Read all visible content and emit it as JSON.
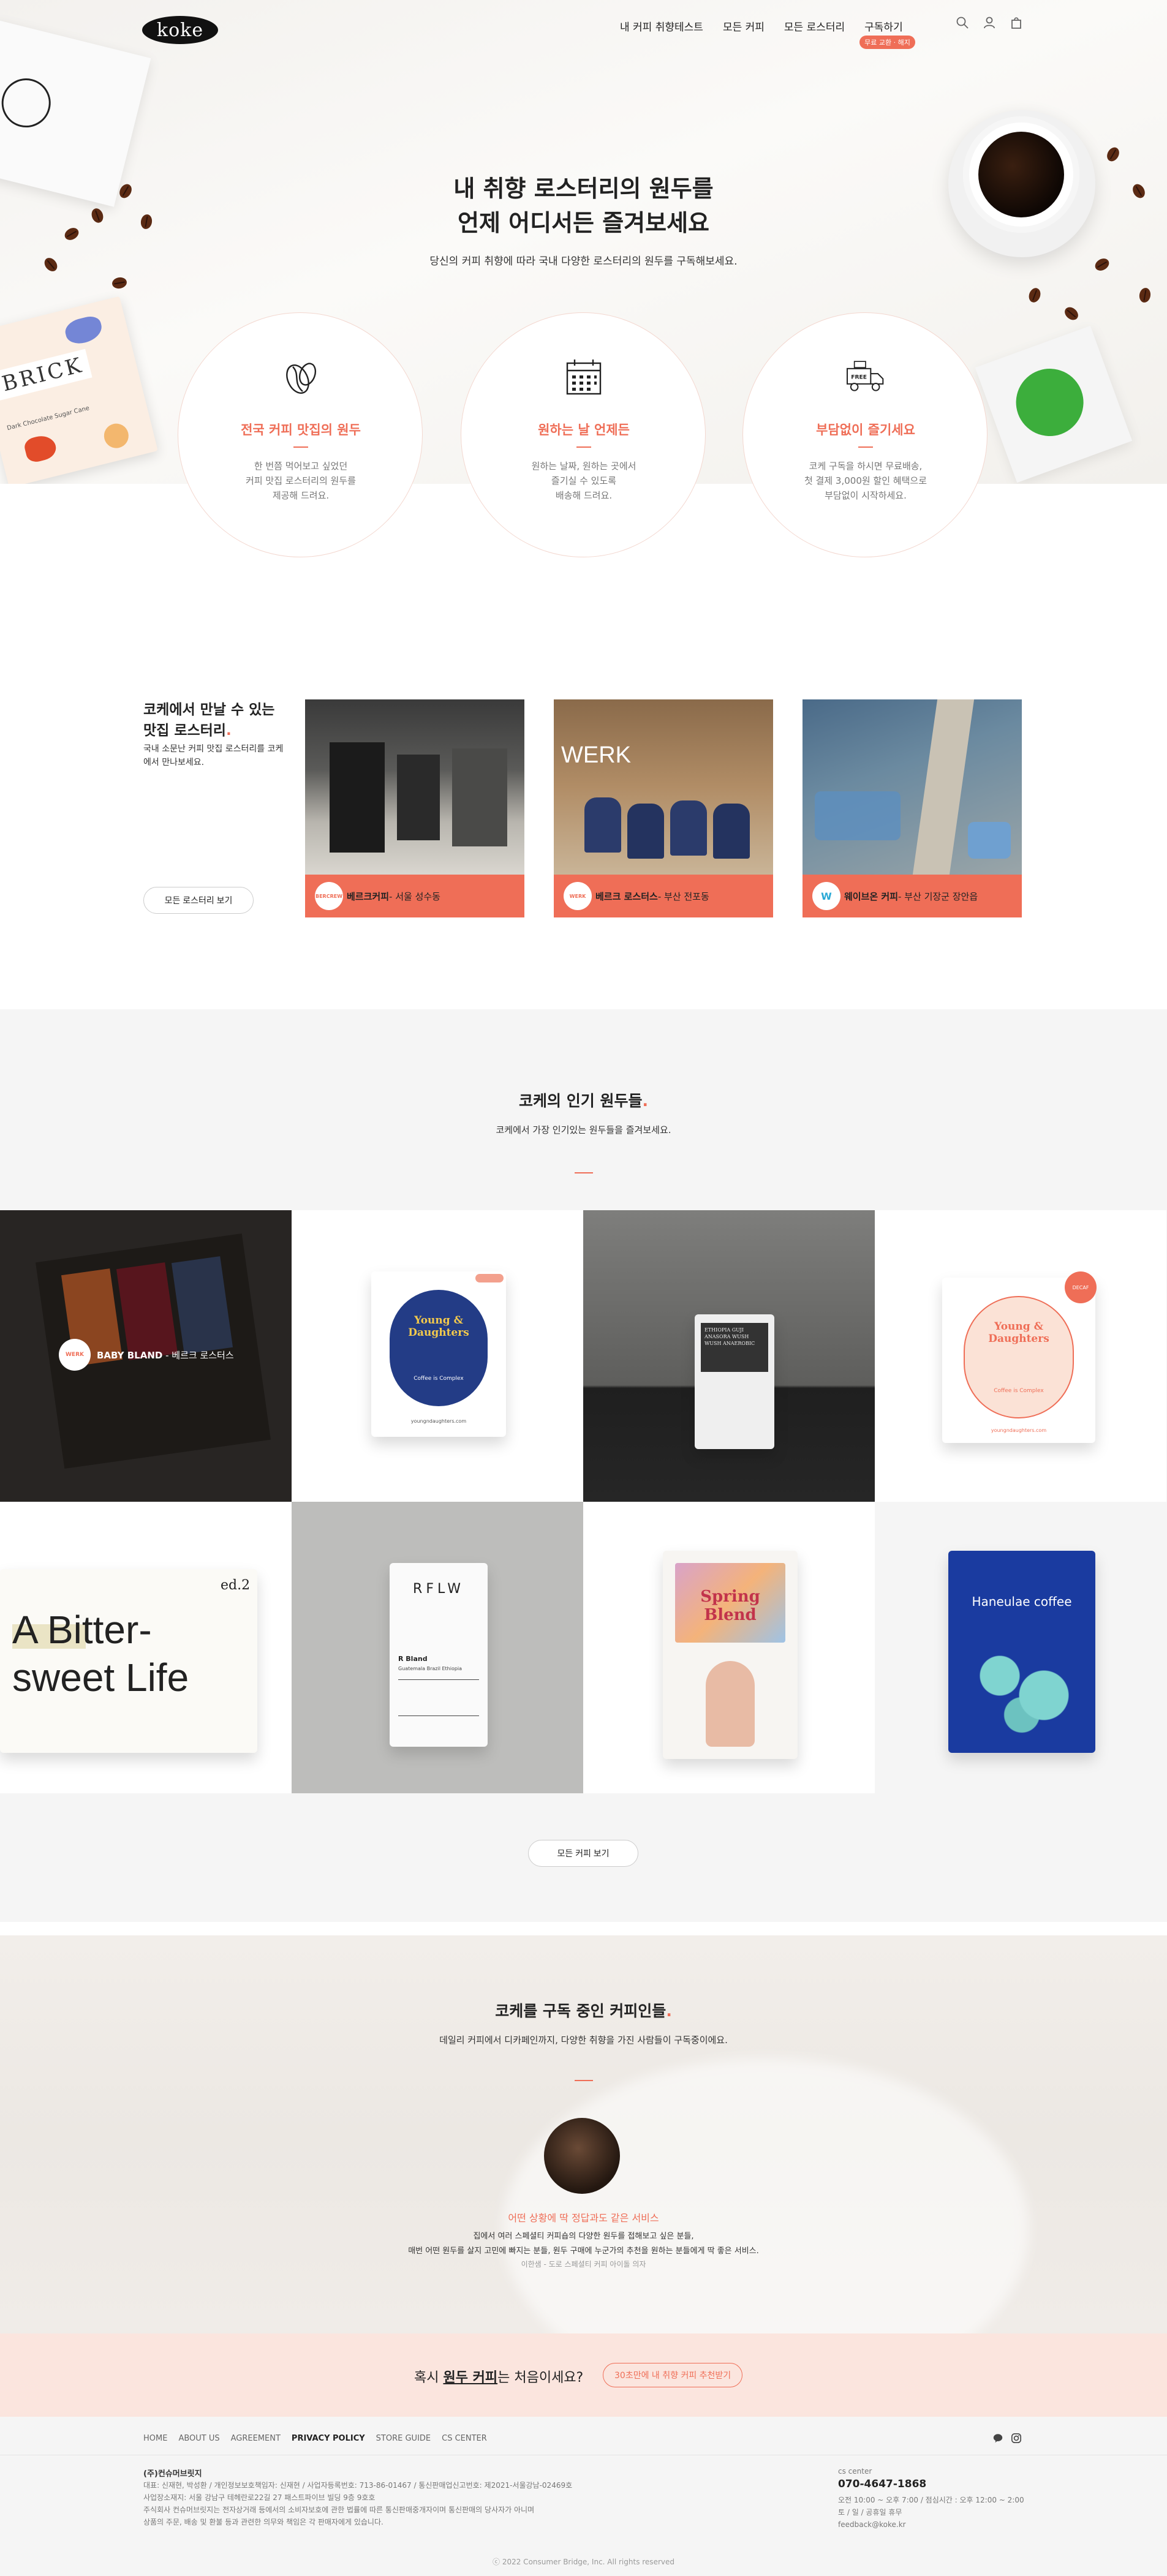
{
  "brand": {
    "logo_text": "koke",
    "accent": "#ef6e57"
  },
  "nav": {
    "items": [
      "내 커피 취향테스트",
      "모든 커피",
      "모든 로스터리",
      "구독하기"
    ],
    "subscribe_badge": "무료 교환 · 해지"
  },
  "header_icons": [
    "search-icon",
    "user-icon",
    "cart-icon"
  ],
  "hero": {
    "title_line1": "내 취향 로스터리의 원두를",
    "title_line2": "언제 어디서든 즐겨보세요",
    "subtitle": "당신의 커피 취향에 따라 국내 다양한 로스터리의 원두를 구독해보세요.",
    "package_text": "BRICK",
    "package_sub": "Dark Chocolate Sugar Cane",
    "free_truck_label": "FREE"
  },
  "features": [
    {
      "icon": "coffee-bean-icon",
      "title": "전국 커피 맛집의 원두",
      "desc": "한 번쯤 먹어보고 싶었던\n커피 맛집 로스터리의 원두를\n제공해 드려요."
    },
    {
      "icon": "calendar-icon",
      "title": "원하는 날 언제든",
      "desc": "원하는 날짜, 원하는 곳에서\n즐기실 수 있도록\n배송해 드려요."
    },
    {
      "icon": "free-delivery-truck-icon",
      "title": "부담없이 즐기세요",
      "desc": "코케 구독을 하시면 무료배송,\n첫 결제 3,000원 할인 혜택으로\n부담없이 시작하세요."
    }
  ],
  "roasters": {
    "title_line1": "코케에서 만날 수 있는",
    "title_line2": "맛집 로스터리",
    "title_dot": ".",
    "desc": "국내 소문난 커피 맛집 로스터리를 코케에서 만나보세요.",
    "button": "모든 로스터리 보기",
    "cards": [
      {
        "name": "베르크커피",
        "location": " - 서울 성수동",
        "logo": "BERCREW"
      },
      {
        "name": "베르크 로스터스",
        "location": " - 부산 전포동",
        "logo": "WERK",
        "photo_text": "WERK"
      },
      {
        "name": "웨이브온 커피",
        "location": " - 부산 기장군 장안읍",
        "logo": "W"
      }
    ]
  },
  "popular": {
    "title": "코케의 인기 원두들",
    "title_dot": ".",
    "subtitle": "코케에서 가장 인기있는 원두들을 즐겨보세요.",
    "overlay_brand": "BABY BLAND",
    "overlay_roaster": " - 베르크 로스터스",
    "overlay_logo": "WERK",
    "products": [
      {
        "label": "Young & Daughters",
        "sub": "Coffee is Complex",
        "site": "youngndaughters.com"
      },
      {
        "label": "ETHIOPIA GUJI ANASORA WUSH WUSH ANAEROBIC"
      },
      {
        "label": "Young & Daughters",
        "sub": "Coffee is Complex",
        "site": "youngndaughters.com",
        "badge": "DECAF"
      },
      {
        "label": "A Bitter-sweet Life",
        "top": "ed.2"
      },
      {
        "label": "RFLW",
        "sub": "R Bland",
        "detail": "Guatemala Brazil Ethiopia"
      },
      {
        "label": "Spring Blend"
      },
      {
        "label": "Haneulae coffee"
      }
    ],
    "button": "모든 커피 보기"
  },
  "subscribers": {
    "title": "코케를 구독 중인 커피인들",
    "title_dot": ".",
    "subtitle": "데일리 커피에서 디카페인까지, 다양한 취향을 가진 사람들이 구독중이에요.",
    "quote_title": "어떤 상황에 딱 정답과도 같은 서비스",
    "quote_text": "집에서 여러 스페셜티 커피숍의 다양한 원두를 접해보고 싶은 분들,\n매번 어떤 원두를 살지 고민에 빠지는 분들, 원두 구매에 누군가의 추천을 원하는 분들에게 딱 좋은 서비스.",
    "quote_by": "이한샘 - 도로 스페셜티 커피 아이돌 의자"
  },
  "cta": {
    "prefix": "혹시 ",
    "emphasis": "원두 커피",
    "suffix": "는 처음이세요?",
    "button": "30초만에 내 취향 커피 추천받기"
  },
  "footer": {
    "nav": [
      "HOME",
      "ABOUT US",
      "AGREEMENT",
      "PRIVACY POLICY",
      "STORE GUIDE",
      "CS CENTER"
    ],
    "company": "(주)컨슈머브릿지",
    "info": "대표: 신재현, 박성환 / 개인정보보호책임자: 신재현 / 사업자등록번호: 713-86-01467 / 통신판매업신고번호: 제2021-서울강남-02469호\n사업장소재지: 서울 강남구 테헤란로22길 27 패스트파이브 빌딩 9층 9호호\n주식회사 컨슈머브릿지는 전자상거래 등에서의 소비자보호에 관한 법률에 따른 통신판매중개자이며 통신판매의 당사자가 아니며\n상품의 주문, 배송 및 환불 등과 관련한 의무와 책임은 각 판매자에게 있습니다.",
    "cs_label": "cs center",
    "phone": "070-4647-1868",
    "hours": "오전 10:00 ~ 오후 7:00 / 점심시간 : 오후 12:00 ~ 2:00\n토 / 일 / 공휴일 휴무\nfeedback@koke.kr",
    "social": [
      "kakao-icon",
      "instagram-icon"
    ],
    "copyright": "ⓒ 2022 Consumer Bridge, Inc. All rights reserved"
  }
}
